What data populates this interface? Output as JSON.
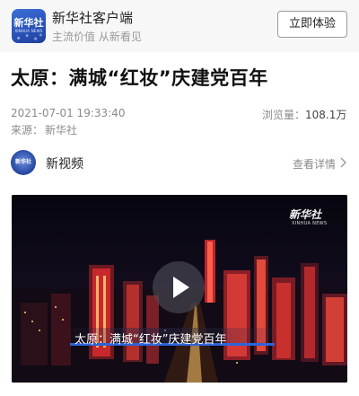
{
  "banner": {
    "logo_text": "新华社",
    "logo_sub": "XINHUA NEWS",
    "app_name": "新华社客户端",
    "slogan": "主流价值 从新看见",
    "try_button": "立即体验"
  },
  "article": {
    "title": "太原：满城“红妆”庆建党百年",
    "pub_time": "2021-07-01 19:33:40",
    "views_label": "浏览量：",
    "views_value": "108.1万",
    "source_label": "来源：",
    "source_value": "新华社"
  },
  "channel": {
    "avatar_text": "新华社",
    "name": "新视频",
    "detail_link": "查看详情"
  },
  "video": {
    "watermark": "新华社",
    "watermark_sub": "XINHUA NEWS",
    "subtitle": "太原：满城“红妆”庆建党百年"
  },
  "colors": {
    "accent_blue": "#2d63d8",
    "logo_blue": "#1d3f9e",
    "muted_text": "#8a8a8a"
  }
}
